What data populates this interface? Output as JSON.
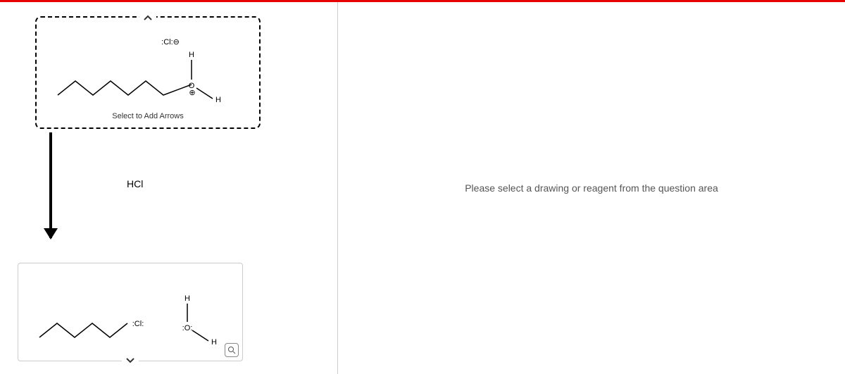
{
  "instruction": "Please select a drawing or reagent from the question area",
  "reactant": {
    "select_label": "Select to Add Arrows",
    "leaving_group": ":Cl:⊖",
    "h_top": "H",
    "h_right": "H",
    "charge": "⊕"
  },
  "reagent": "HCl",
  "product": {
    "cl_label": "Cl",
    "h_top": "H",
    "h_right": "H",
    "o_label": "O"
  }
}
